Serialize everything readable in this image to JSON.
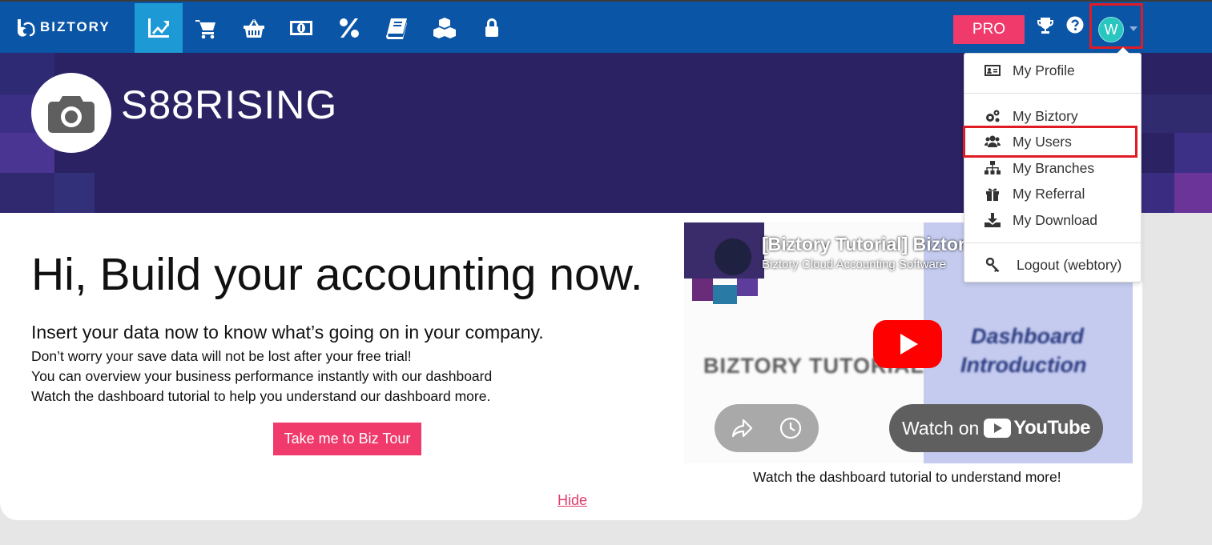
{
  "brand": {
    "name": "BIZTORY"
  },
  "nav": {
    "icons": [
      "chart-line-icon",
      "shopping-cart-icon",
      "basket-icon",
      "money-bill-icon",
      "percent-icon",
      "book-icon",
      "cubes-icon",
      "lock-icon"
    ],
    "active": "chart-line-icon",
    "pro_label": "PRO",
    "avatar_initial": "W"
  },
  "hero": {
    "company_name": "S88RISING"
  },
  "main": {
    "headline": "Hi, Build your accounting now.",
    "subhead": "Insert your data now to know what’s going on in your company.",
    "lines": [
      "Don’t worry your save data will not be lost after your free trial!",
      "You can overview your business performance instantly with our dashboard",
      "Watch the dashboard tutorial to help you understand our dashboard more."
    ],
    "tour_button": "Take me to Biz Tour",
    "hide_link": "Hide"
  },
  "video": {
    "title": "[Biztory Tutorial] Biztory I",
    "channel": "Biztory Cloud Accounting Software",
    "thumb_left_text": "BIZTORY TUTORIAL",
    "thumb_right_line1": "Dashboard",
    "thumb_right_line2": "Introduction",
    "watch_on": "Watch on",
    "youtube": "YouTube",
    "caption": "Watch the dashboard tutorial to understand more!"
  },
  "user_menu": {
    "items": [
      {
        "label": "My Profile",
        "icon": "id-card-icon"
      },
      {
        "label": "My Biztory",
        "icon": "cogs-icon"
      },
      {
        "label": "My Users",
        "icon": "users-icon"
      },
      {
        "label": "My Branches",
        "icon": "sitemap-icon"
      },
      {
        "label": "My Referral",
        "icon": "gift-icon"
      },
      {
        "label": "My Download",
        "icon": "download-icon"
      },
      {
        "label": "Logout (webtory)",
        "icon": "key-icon"
      }
    ],
    "highlighted": "My Users"
  },
  "colors": {
    "navbar": "#0b55a6",
    "active_nav": "#1d9ad6",
    "accent": "#ef3a6b",
    "hero": "#2a2262",
    "highlight_border": "#e01b24"
  }
}
